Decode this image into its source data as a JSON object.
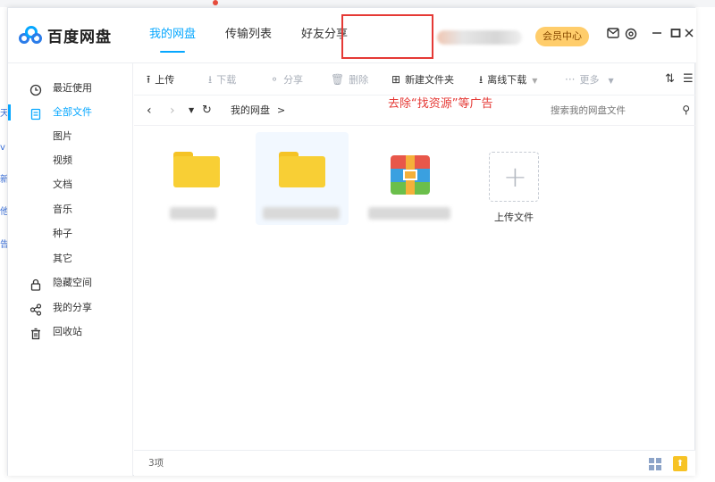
{
  "app": {
    "logo_text": "百度网盘"
  },
  "header": {
    "nav": [
      {
        "label": "我的网盘",
        "active": true
      },
      {
        "label": "传输列表",
        "active": false
      },
      {
        "label": "好友分享",
        "active": false
      }
    ],
    "vip_label": "会员中心"
  },
  "sidebar": {
    "items": [
      {
        "label": "最近使用",
        "icon": "clock-icon"
      },
      {
        "label": "全部文件",
        "icon": "document-icon",
        "active": true
      },
      {
        "label": "图片"
      },
      {
        "label": "视频"
      },
      {
        "label": "文档"
      },
      {
        "label": "音乐"
      },
      {
        "label": "种子"
      },
      {
        "label": "其它"
      },
      {
        "label": "隐藏空间",
        "icon": "lock-icon"
      },
      {
        "label": "我的分享",
        "icon": "share-icon"
      },
      {
        "label": "回收站",
        "icon": "trash-icon"
      }
    ]
  },
  "toolbar": {
    "upload": "上传",
    "download": "下载",
    "share": "分享",
    "delete": "删除",
    "new_folder": "新建文件夹",
    "offline_download": "离线下载",
    "more": "更多"
  },
  "pathbar": {
    "breadcrumb": "我的网盘",
    "separator": ">",
    "annotation": "去除“找资源”等广告",
    "search_placeholder": "搜索我的网盘文件"
  },
  "files": {
    "upload_label": "上传文件",
    "plus": "+"
  },
  "footer": {
    "count": "3项"
  },
  "left_fragments": [
    "天",
    "v",
    "新",
    "他",
    "告"
  ],
  "colors": {
    "accent": "#06a7ff",
    "annotation": "#e53935",
    "folder": "#f8cf35",
    "vip": "#ffcd6b"
  }
}
